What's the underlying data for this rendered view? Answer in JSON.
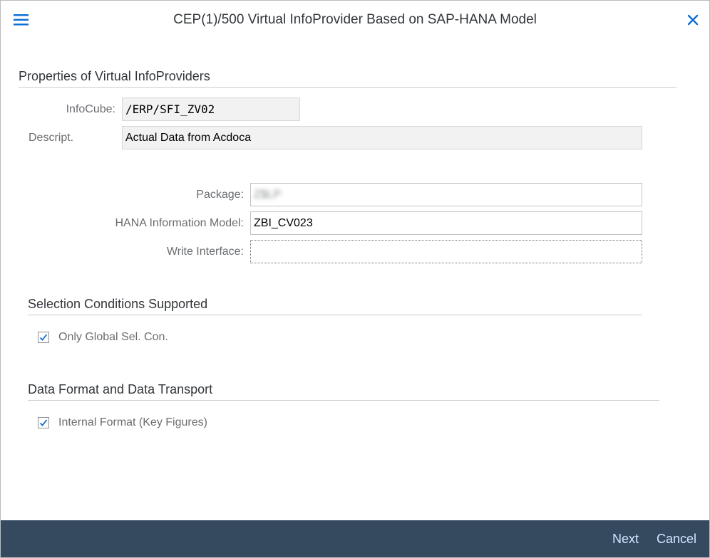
{
  "window": {
    "title": "CEP(1)/500 Virtual InfoProvider Based on SAP-HANA Model"
  },
  "properties": {
    "heading": "Properties of Virtual InfoProviders",
    "infocube_label": "InfoCube:",
    "infocube_value": "/ERP/SFI_ZV02",
    "descript_label": "Descript.",
    "descript_value": "Actual Data from Acdoca",
    "package_label": "Package:",
    "package_value": "Z$LP",
    "hana_model_label": "HANA Information Model:",
    "hana_model_value": "ZBI_CV023",
    "write_interface_label": "Write Interface:",
    "write_interface_value": ""
  },
  "selection": {
    "heading": "Selection Conditions Supported",
    "only_global_label": "Only Global Sel. Con.",
    "only_global_checked": true
  },
  "transport": {
    "heading": "Data Format and Data Transport",
    "internal_format_label": "Internal Format (Key Figures)",
    "internal_format_checked": true
  },
  "footer": {
    "next_label": "Next",
    "cancel_label": "Cancel"
  },
  "colors": {
    "footer_bg": "#354a5f",
    "footer_button_text": "#d1e8ff",
    "icon_blue": "#0a6ed1"
  }
}
